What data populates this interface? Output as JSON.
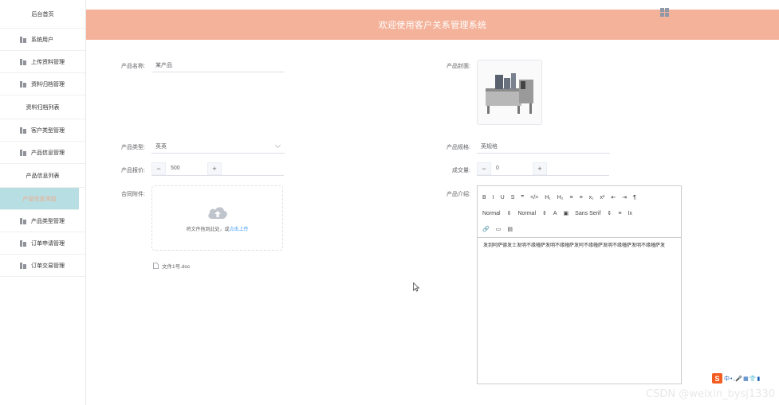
{
  "sidebar": {
    "items": [
      {
        "label": "后台首页",
        "type": "plain"
      },
      {
        "label": "系统用户",
        "type": "icon"
      },
      {
        "label": "上传资料管理",
        "type": "icon"
      },
      {
        "label": "资料归档管理",
        "type": "icon"
      },
      {
        "label": "资料归档列表",
        "type": "sub"
      },
      {
        "label": "客户类型管理",
        "type": "icon"
      },
      {
        "label": "产品信息管理",
        "type": "icon"
      },
      {
        "label": "产品信息列表",
        "type": "sub"
      },
      {
        "label": "产品信息添加",
        "type": "active"
      },
      {
        "label": "产品类型管理",
        "type": "icon"
      },
      {
        "label": "订单申请管理",
        "type": "icon"
      },
      {
        "label": "订单交易管理",
        "type": "icon"
      }
    ]
  },
  "header": {
    "title": "欢迎使用客户关系管理系统"
  },
  "form": {
    "name_label": "产品名称:",
    "name_value": "某产品",
    "cover_label": "产品封面:",
    "type_label": "产品类型:",
    "type_value": "英英",
    "spec_label": "产品规格:",
    "spec_value": "英规格",
    "price_label": "产品报价:",
    "price_value": "500",
    "volume_label": "成交量:",
    "volume_value": "0",
    "attachment_label": "合同附件:",
    "upload_text": "将文件拖到此处，或",
    "upload_link": "点击上传",
    "file_name": "文件1号.doc",
    "intro_label": "产品介绍:"
  },
  "editor": {
    "row1": [
      "B",
      "I",
      "U",
      "S",
      "❞",
      "</>",
      "H₁",
      "H₂",
      "≡",
      "≡",
      "x₁",
      "x²",
      "⇤",
      "⇥",
      "¶"
    ],
    "row2": [
      "Normal",
      "⇕",
      "Normal",
      "⇕",
      "A",
      "▣",
      "Sans Serif",
      "⇕",
      "≡",
      "Ix"
    ],
    "row3": [
      "🔗",
      "▭",
      "▤"
    ],
    "content": "发到阿萨德发士发明不缘幢萨发明不缘幢萨发阿不缘幢萨发明不缘幢萨发明不缘幢萨发"
  },
  "watermark": "CSDN @weixin_bysj1330",
  "stepper": {
    "minus": "−",
    "plus": "+"
  },
  "colors": {
    "header": "#f4b29a",
    "active_bg": "#b7dfe3",
    "active_text": "#f0a988",
    "link": "#409eff"
  }
}
